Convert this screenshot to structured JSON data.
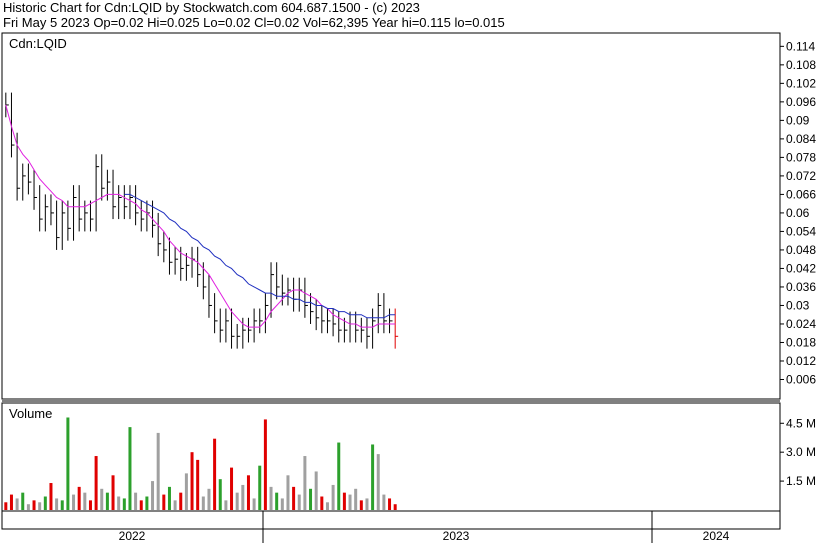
{
  "header": {
    "line1": "Historic Chart for Cdn:LQID by Stockwatch.com 604.687.1500 - (c) 2023",
    "line2": "Fri May  5 2023  Op=0.02  Hi=0.025  Lo=0.02  Cl=0.02  Vol=62,395  Year hi=0.115  lo=0.015"
  },
  "colors": {
    "ma_short": "#e020e0",
    "ma_long": "#2030c0",
    "volume_up": "#2ca02c",
    "volume_down": "#e00000",
    "volume_flat": "#a0a0a0",
    "price_bar": "#000000",
    "last_bar": "#e00000"
  },
  "chart_data": {
    "type": "line",
    "symbol_label": "Cdn:LQID",
    "volume_label": "Volume",
    "x_labels": [
      "2022",
      "2023",
      "2024"
    ],
    "price_axis": {
      "ticks": [
        "0.114",
        "0.108",
        "0.102",
        "0.096",
        "0.09",
        "0.084",
        "0.078",
        "0.072",
        "0.066",
        "0.06",
        "0.054",
        "0.048",
        "0.042",
        "0.036",
        "0.03",
        "0.024",
        "0.018",
        "0.012",
        "0.006"
      ],
      "ylim": [
        0.0,
        0.118
      ]
    },
    "volume_axis": {
      "ticks": [
        "4.5 M",
        "3.0 M",
        "1.5 M"
      ],
      "ylim": [
        0,
        5.5
      ]
    },
    "price_series_weekly": {
      "x": [
        "2022-01-07",
        "2022-01-14",
        "2022-01-21",
        "2022-01-28",
        "2022-02-04",
        "2022-02-11",
        "2022-02-18",
        "2022-02-25",
        "2022-03-04",
        "2022-03-11",
        "2022-03-18",
        "2022-03-25",
        "2022-04-01",
        "2022-04-08",
        "2022-04-15",
        "2022-04-22",
        "2022-04-29",
        "2022-05-06",
        "2022-05-13",
        "2022-05-20",
        "2022-05-27",
        "2022-06-03",
        "2022-06-10",
        "2022-06-17",
        "2022-06-24",
        "2022-07-01",
        "2022-07-08",
        "2022-07-15",
        "2022-07-22",
        "2022-07-29",
        "2022-08-05",
        "2022-08-12",
        "2022-08-19",
        "2022-08-26",
        "2022-09-02",
        "2022-09-09",
        "2022-09-16",
        "2022-09-23",
        "2022-09-30",
        "2022-10-07",
        "2022-10-14",
        "2022-10-21",
        "2022-10-28",
        "2022-11-04",
        "2022-11-11",
        "2022-11-18",
        "2022-11-25",
        "2022-12-02",
        "2022-12-09",
        "2022-12-16",
        "2022-12-23",
        "2022-12-30",
        "2023-01-06",
        "2023-01-13",
        "2023-01-20",
        "2023-01-27",
        "2023-02-03",
        "2023-02-10",
        "2023-02-17",
        "2023-02-24",
        "2023-03-03",
        "2023-03-10",
        "2023-03-17",
        "2023-03-24",
        "2023-03-31",
        "2023-04-07",
        "2023-04-14",
        "2023-04-21",
        "2023-04-28",
        "2023-05-05"
      ],
      "close": [
        0.095,
        0.082,
        0.068,
        0.072,
        0.07,
        0.065,
        0.058,
        0.062,
        0.06,
        0.052,
        0.06,
        0.055,
        0.065,
        0.058,
        0.06,
        0.058,
        0.075,
        0.068,
        0.07,
        0.062,
        0.065,
        0.062,
        0.065,
        0.06,
        0.058,
        0.06,
        0.056,
        0.05,
        0.048,
        0.044,
        0.045,
        0.042,
        0.043,
        0.045,
        0.04,
        0.036,
        0.03,
        0.025,
        0.022,
        0.025,
        0.02,
        0.02,
        0.022,
        0.022,
        0.025,
        0.025,
        0.03,
        0.04,
        0.036,
        0.034,
        0.035,
        0.032,
        0.035,
        0.03,
        0.028,
        0.026,
        0.025,
        0.025,
        0.024,
        0.022,
        0.022,
        0.024,
        0.022,
        0.022,
        0.02,
        0.025,
        0.03,
        0.025,
        0.025,
        0.02
      ]
    },
    "ma_short_values": [
      0.095,
      0.088,
      0.082,
      0.079,
      0.077,
      0.074,
      0.071,
      0.069,
      0.067,
      0.065,
      0.064,
      0.062,
      0.062,
      0.062,
      0.062,
      0.063,
      0.064,
      0.065,
      0.066,
      0.066,
      0.066,
      0.065,
      0.064,
      0.063,
      0.061,
      0.06,
      0.058,
      0.056,
      0.054,
      0.051,
      0.049,
      0.047,
      0.046,
      0.045,
      0.044,
      0.042,
      0.04,
      0.037,
      0.034,
      0.031,
      0.028,
      0.026,
      0.024,
      0.023,
      0.023,
      0.023,
      0.025,
      0.028,
      0.03,
      0.032,
      0.034,
      0.035,
      0.035,
      0.034,
      0.033,
      0.032,
      0.03,
      0.029,
      0.027,
      0.026,
      0.025,
      0.024,
      0.024,
      0.023,
      0.023,
      0.023,
      0.024,
      0.024,
      0.024,
      0.024
    ],
    "ma_long_values": [
      null,
      null,
      null,
      null,
      null,
      null,
      null,
      null,
      null,
      null,
      null,
      null,
      null,
      null,
      null,
      null,
      null,
      null,
      null,
      null,
      null,
      0.066,
      0.066,
      0.065,
      0.064,
      0.063,
      0.062,
      0.061,
      0.06,
      0.058,
      0.057,
      0.055,
      0.054,
      0.052,
      0.051,
      0.049,
      0.048,
      0.046,
      0.045,
      0.043,
      0.042,
      0.04,
      0.039,
      0.037,
      0.036,
      0.035,
      0.034,
      0.034,
      0.033,
      0.033,
      0.033,
      0.032,
      0.032,
      0.031,
      0.031,
      0.03,
      0.03,
      0.029,
      0.029,
      0.028,
      0.028,
      0.027,
      0.027,
      0.027,
      0.026,
      0.026,
      0.026,
      0.026,
      0.027,
      0.027
    ],
    "volume_series_weekly_m": [
      0.4,
      0.8,
      0.6,
      0.9,
      0.3,
      0.5,
      0.4,
      0.7,
      1.4,
      0.6,
      0.5,
      4.8,
      0.8,
      1.2,
      0.9,
      0.5,
      2.8,
      1.1,
      0.9,
      1.8,
      0.7,
      0.6,
      4.3,
      0.9,
      0.5,
      0.7,
      1.5,
      4.0,
      0.8,
      1.2,
      0.5,
      0.9,
      1.9,
      3.0,
      2.6,
      0.7,
      1.1,
      3.7,
      1.6,
      0.5,
      2.2,
      0.9,
      1.3,
      1.8,
      0.6,
      2.3,
      4.7,
      1.2,
      0.9,
      0.6,
      1.8,
      1.2,
      0.8,
      2.8,
      1.1,
      2.0,
      0.7,
      0.4,
      1.3,
      3.5,
      0.9,
      0.8,
      1.1,
      0.5,
      0.6,
      3.4,
      2.9,
      0.8,
      0.6,
      0.3
    ],
    "volume_colors": [
      "down",
      "down",
      "flat",
      "up",
      "flat",
      "down",
      "flat",
      "up",
      "down",
      "flat",
      "up",
      "up",
      "flat",
      "down",
      "flat",
      "down",
      "down",
      "flat",
      "up",
      "down",
      "flat",
      "up",
      "up",
      "flat",
      "down",
      "up",
      "flat",
      "flat",
      "down",
      "up",
      "flat",
      "down",
      "flat",
      "down",
      "down",
      "flat",
      "flat",
      "down",
      "up",
      "flat",
      "down",
      "flat",
      "flat",
      "down",
      "flat",
      "up",
      "down",
      "flat",
      "up",
      "flat",
      "flat",
      "down",
      "flat",
      "flat",
      "up",
      "flat",
      "down",
      "flat",
      "flat",
      "up",
      "down",
      "flat",
      "flat",
      "down",
      "flat",
      "up",
      "flat",
      "flat",
      "down",
      "down"
    ],
    "grid": false,
    "legend": "none"
  }
}
